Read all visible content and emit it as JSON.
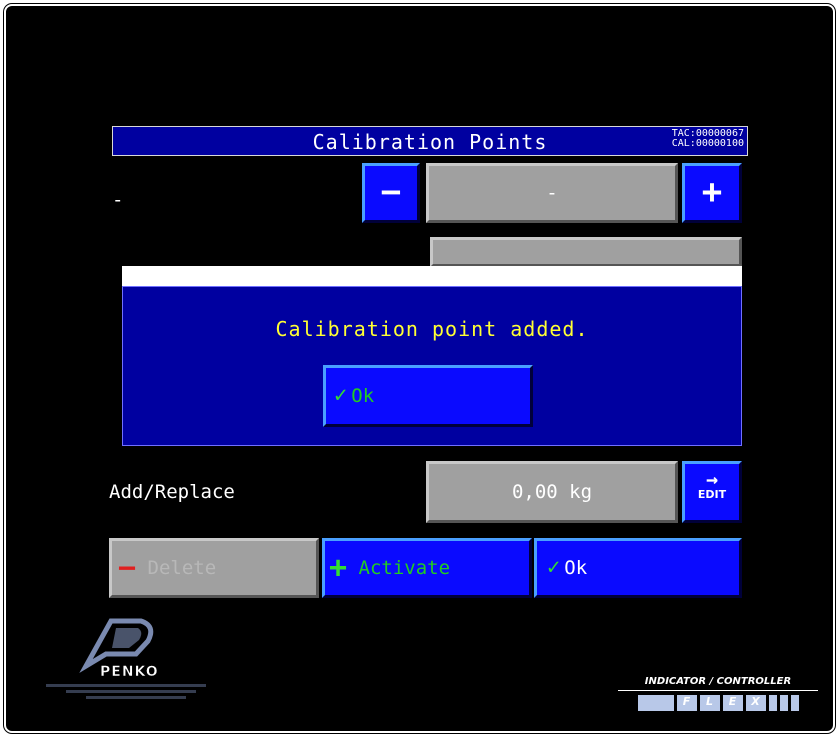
{
  "title": "Calibration Points",
  "counters": {
    "tac": "TAC:00000067",
    "cal": "CAL:00000100"
  },
  "rows": {
    "row1_label": "-",
    "row1_value": "-",
    "row4_label": "Add/Replace",
    "row4_value": "0,00 kg"
  },
  "stepper": {
    "minus": "−",
    "plus": "+"
  },
  "edit_label": "EDIT",
  "dialog": {
    "message": "Calibration point added.",
    "ok_label": "Ok"
  },
  "bottom_buttons": {
    "delete": "Delete",
    "activate": "Activate",
    "ok": "Ok"
  },
  "branding": {
    "penko": "PENKO",
    "product": "INDICATOR / CONTROLLER",
    "flex": "FLEX"
  },
  "colors": {
    "panel_blue": "#0000a0",
    "button_blue": "#0a0aff",
    "message_yellow": "#ffff33",
    "ok_green": "#22cc22"
  }
}
